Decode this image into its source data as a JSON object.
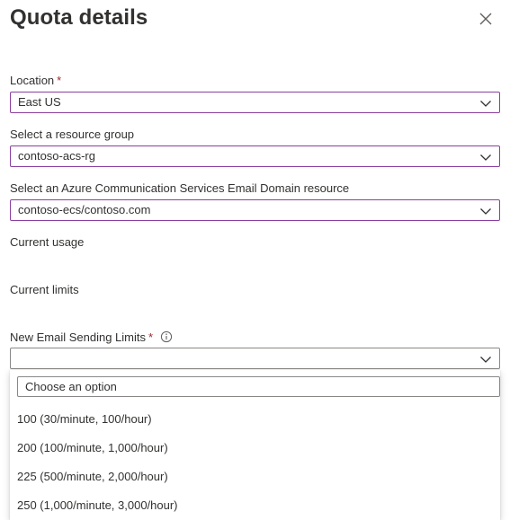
{
  "panel": {
    "title": "Quota details",
    "close_icon": "close-icon"
  },
  "location": {
    "label": "Location",
    "required_mark": "*",
    "value": "East US"
  },
  "resource_group": {
    "label": "Select a resource group",
    "value": "contoso-acs-rg"
  },
  "email_domain": {
    "label": "Select an Azure Communication Services Email Domain resource",
    "value": "contoso-ecs/contoso.com"
  },
  "current_usage": {
    "label": "Current usage"
  },
  "current_limits": {
    "label": "Current limits"
  },
  "new_limits": {
    "label": "New Email Sending Limits",
    "required_mark": "*",
    "info_icon": "info-icon",
    "value": "",
    "dropdown": {
      "filter_placeholder": "Choose an option",
      "options": [
        "100 (30/minute, 100/hour)",
        "200 (100/minute, 1,000/hour)",
        "225 (500/minute, 2,000/hour)",
        "250 (1,000/minute, 3,000/hour)"
      ]
    }
  },
  "colors": {
    "focus_border": "#8a3fa0",
    "required": "#a4262c",
    "text": "#323130",
    "border": "#8a8886"
  }
}
